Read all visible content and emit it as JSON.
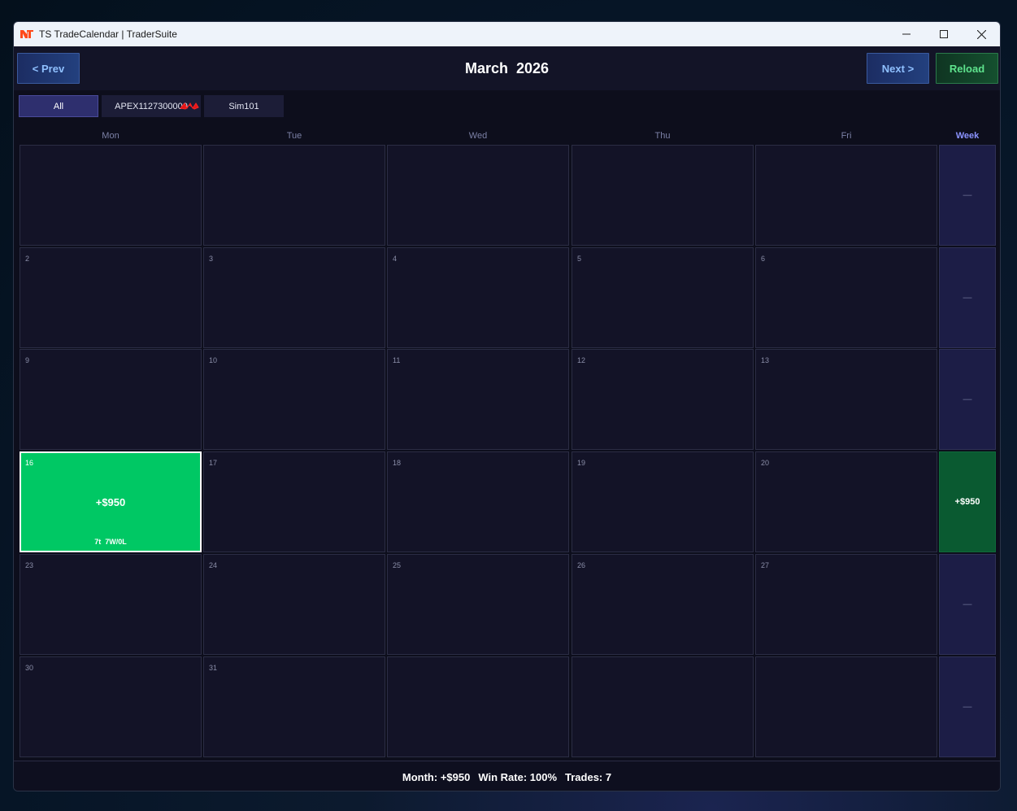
{
  "window": {
    "title": "TS TradeCalendar  |  TraderSuite",
    "controls": {
      "minimize": "—",
      "maximize": "☐",
      "close": "✕"
    }
  },
  "toolbar": {
    "prev_label": "< Prev",
    "month_title": "March  2026",
    "next_label": "Next >",
    "reload_label": "Reload"
  },
  "filters": [
    {
      "label": "All",
      "active": true
    },
    {
      "label": "APEX1127300000",
      "active": false
    },
    {
      "label": "Sim101",
      "active": false
    }
  ],
  "calendar": {
    "headers": [
      "Mon",
      "Tue",
      "Wed",
      "Thu",
      "Fri"
    ],
    "week_header": "Week",
    "weeks": [
      {
        "days": [
          "",
          "",
          "",
          "",
          ""
        ],
        "week_total": "—"
      },
      {
        "days": [
          "2",
          "3",
          "4",
          "5",
          "6"
        ],
        "week_total": "—"
      },
      {
        "days": [
          "9",
          "10",
          "11",
          "12",
          "13"
        ],
        "week_total": "—"
      },
      {
        "days": [
          "16",
          "17",
          "18",
          "19",
          "20"
        ],
        "week_total": "+$950"
      },
      {
        "days": [
          "23",
          "24",
          "25",
          "26",
          "27"
        ],
        "week_total": "—"
      },
      {
        "days": [
          "30",
          "31",
          "",
          "",
          ""
        ],
        "week_total": "—"
      }
    ],
    "trade_day": {
      "day": "16",
      "pnl": "+$950",
      "stats": "7t  7W/0L"
    }
  },
  "footer": {
    "month": "Month: +$950",
    "win_rate": "Win Rate: 100%",
    "trades": "Trades: 7"
  },
  "colors": {
    "profit_day": "#00c864",
    "profit_week": "#0a5a31",
    "week_header": "#8b93ff"
  }
}
